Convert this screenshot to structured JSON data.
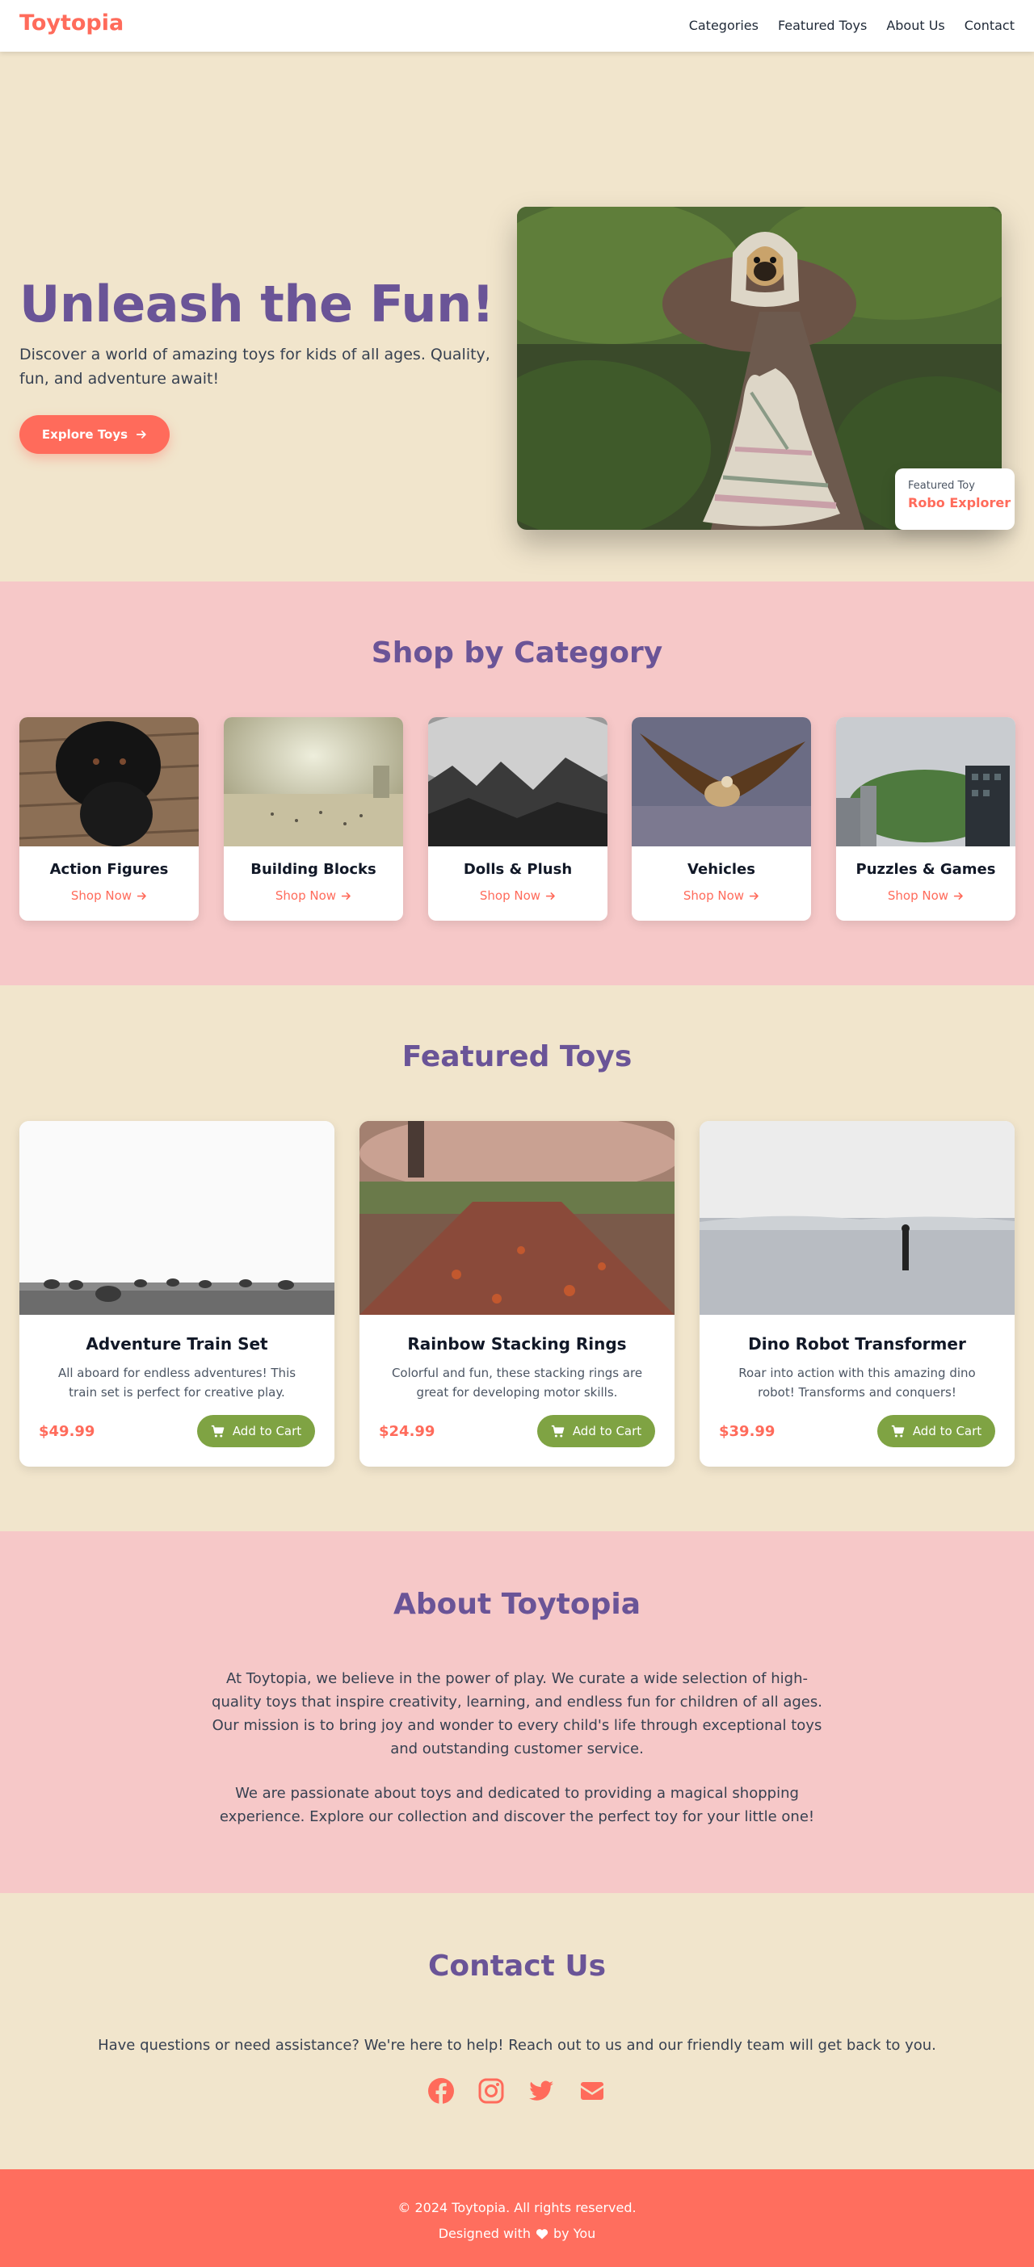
{
  "header": {
    "logo": "Toytopia",
    "nav": [
      "Categories",
      "Featured Toys",
      "About Us",
      "Contact"
    ]
  },
  "hero": {
    "title": "Unleash the Fun!",
    "subtitle": "Discover a world of amazing toys for kids of all ages. Quality, fun, and adventure await!",
    "cta": "Explore Toys",
    "cta_icon": "arrow-right-icon",
    "badge_label": "Featured Toy",
    "badge_name": "Robo Explorer"
  },
  "categories": {
    "title": "Shop by Category",
    "link_label": "Shop Now",
    "items": [
      {
        "name": "Action Figures"
      },
      {
        "name": "Building Blocks"
      },
      {
        "name": "Dolls & Plush"
      },
      {
        "name": "Vehicles"
      },
      {
        "name": "Puzzles & Games"
      }
    ]
  },
  "featured": {
    "title": "Featured Toys",
    "button_label": "Add to Cart",
    "products": [
      {
        "name": "Adventure Train Set",
        "description": "All aboard for endless adventures! This train set is perfect for creative play.",
        "price": "$49.99"
      },
      {
        "name": "Rainbow Stacking Rings",
        "description": "Colorful and fun, these stacking rings are great for developing motor skills.",
        "price": "$24.99"
      },
      {
        "name": "Dino Robot Transformer",
        "description": "Roar into action with this amazing dino robot! Transforms and conquers!",
        "price": "$39.99"
      }
    ]
  },
  "about": {
    "title": "About Toytopia",
    "p1": "At Toytopia, we believe in the power of play. We curate a wide selection of high-quality toys that inspire creativity, learning, and endless fun for children of all ages. Our mission is to bring joy and wonder to every child's life through exceptional toys and outstanding customer service.",
    "p2": "We are passionate about toys and dedicated to providing a magical shopping experience. Explore our collection and discover the perfect toy for your little one!"
  },
  "contact": {
    "title": "Contact Us",
    "text": "Have questions or need assistance? We're here to help! Reach out to us and our friendly team will get back to you.",
    "social": [
      "facebook-icon",
      "instagram-icon",
      "twitter-icon",
      "envelope-icon"
    ]
  },
  "footer": {
    "copyright": "© 2024 Toytopia. All rights reserved.",
    "designed_prefix": "Designed with",
    "designed_suffix": "by You"
  },
  "colors": {
    "brand": "#ff6b5b",
    "heading": "#6a5497",
    "cream": "#f1e5cc",
    "pink": "#f6c8c8",
    "cart_green": "#7fa343"
  }
}
